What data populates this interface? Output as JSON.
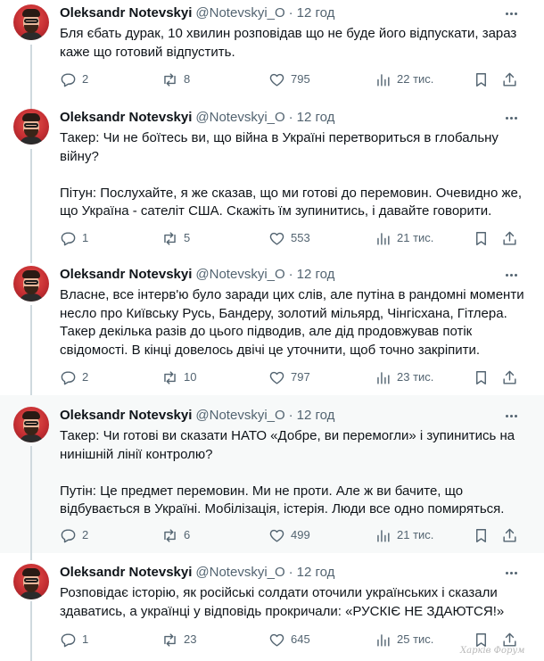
{
  "author": {
    "name": "Oleksandr Notevskyi",
    "handle": "@Notevskyi_O",
    "separator": "·"
  },
  "tweets": [
    {
      "time": "12 год",
      "text": "Бля єбать дурак, 10 хвилин розповідав що не буде його відпускати, зараз\nкаже що готовий відпустить.",
      "replies": "2",
      "retweets": "8",
      "likes": "795",
      "views": "22 тис."
    },
    {
      "time": "12 год",
      "text": "Такер: Чи не боїтесь ви, що війна в Україні перетвориться в глобальну\nвійну?\n\nПітун: Послухайте, я же сказав, що ми готові до перемовин. Очевидно же,\nщо Україна - сателіт США. Скажіть їм зупинитись, і давайте говорити.",
      "replies": "1",
      "retweets": "5",
      "likes": "553",
      "views": "21 тис."
    },
    {
      "time": "12 год",
      "text": "Власне, все інтерв'ю було заради цих слів, але путіна в рандомні моменти\nнесло про Київську Русь, Бандеру, золотий мільярд, Чінгісхана, Гітлера.\nТакер декілька разів до цього підводив, але дід продовжував потік\nсвідомості. В кінці довелось двічі це уточнити, щоб точно закріпити.",
      "replies": "2",
      "retweets": "10",
      "likes": "797",
      "views": "23 тис."
    },
    {
      "time": "12 год",
      "text": "Такер: Чи готові ви сказати НАТО «Добре, ви перемогли» і зупинитись на\nнинішній лінії контролю?\n\nПутін: Це предмет перемовин. Ми не проти. Але ж ви бачите, що\nвідбувається в Україні. Мобілізація, істерія. Люди все одно помиряться.",
      "replies": "2",
      "retweets": "6",
      "likes": "499",
      "views": "21 тис."
    },
    {
      "time": "12 год",
      "text": "Розповідає історію, як російські солдати оточили українських і сказали\nздаватись, а українці у відповідь прокричали: «РУСКІЄ НЕ ЗДАЮТСЯ!»",
      "replies": "1",
      "retweets": "23",
      "likes": "645",
      "views": "25 тис."
    }
  ],
  "icons": {
    "reply": "reply-icon",
    "retweet": "retweet-icon",
    "like": "heart-icon",
    "views": "views-chart-icon",
    "bookmark": "bookmark-icon",
    "share": "share-icon",
    "more": "more-icon"
  },
  "colors": {
    "text": "#0f1419",
    "muted": "#536471",
    "thread_line": "#cfd9de",
    "highlight_bg": "#f7f9f9"
  },
  "watermark": "Харків Форум"
}
